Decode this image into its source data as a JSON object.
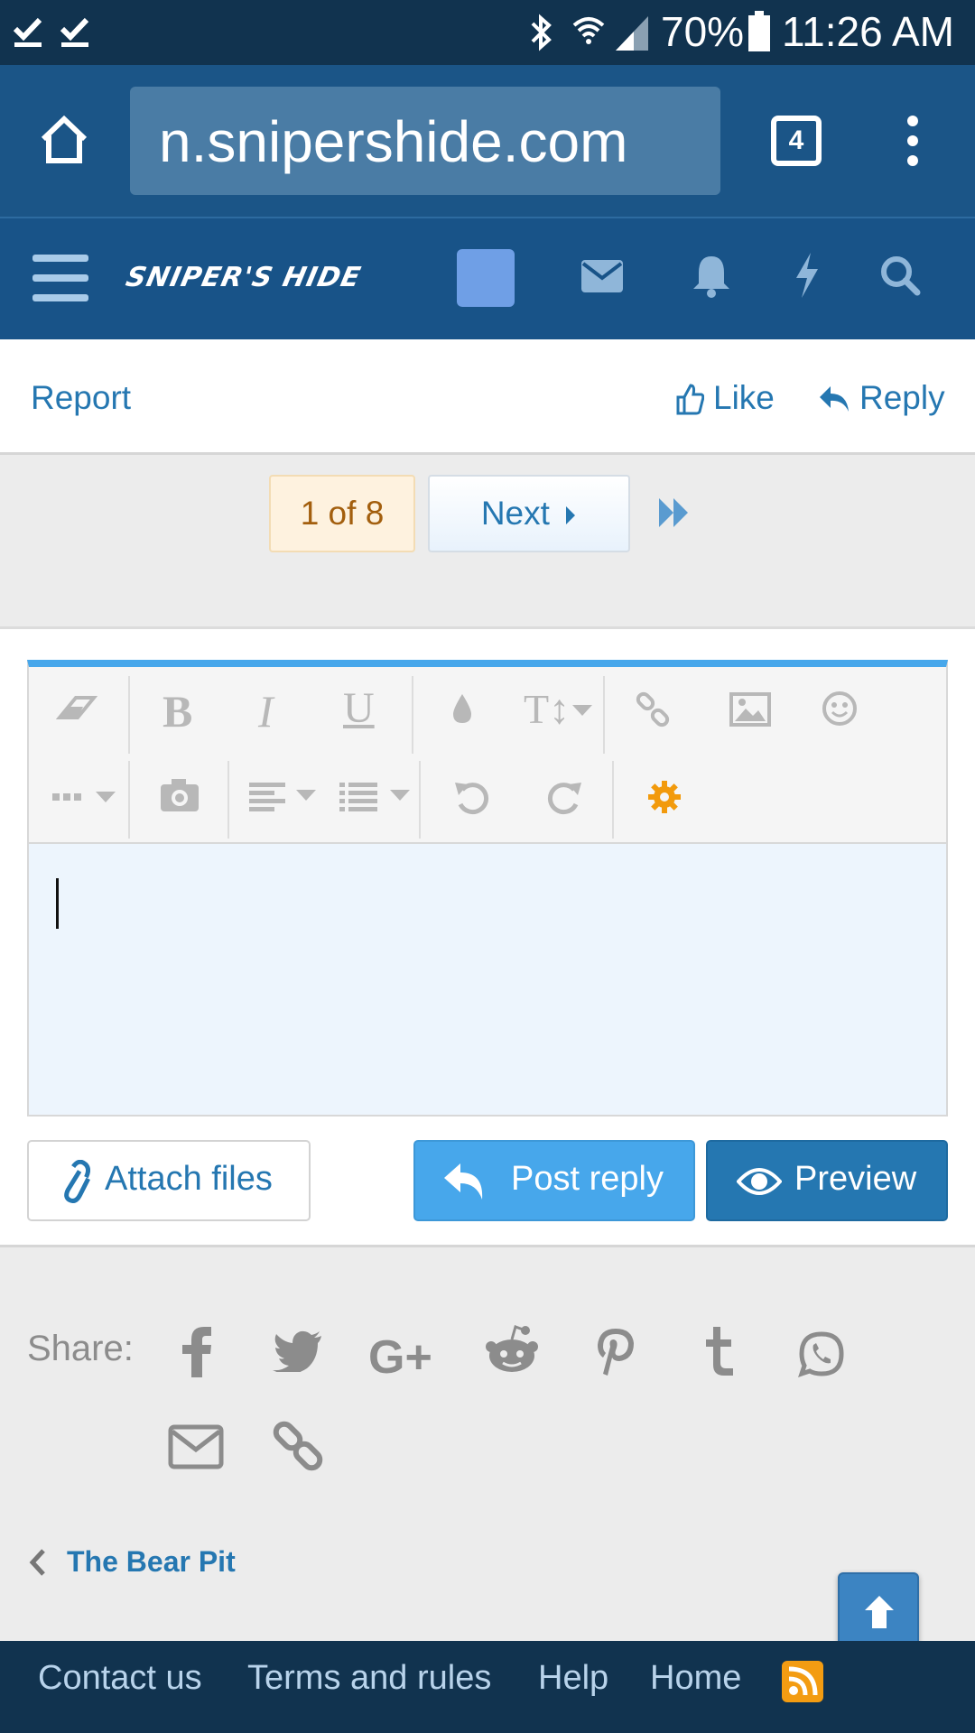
{
  "status_bar": {
    "battery": "70%",
    "time": "11:26 AM"
  },
  "browser": {
    "url": "n.snipershide.com",
    "tab_count": "4"
  },
  "site_nav": {
    "logo_text": "SNIPER'S HIDE"
  },
  "post_actions": {
    "report": "Report",
    "like": "Like",
    "reply": "Reply"
  },
  "pagination": {
    "current": "1 of 8",
    "next": "Next"
  },
  "editor": {
    "text": ""
  },
  "buttons": {
    "attach": "Attach files",
    "post_reply": "Post reply",
    "preview": "Preview"
  },
  "share": {
    "label": "Share:",
    "icons": [
      "facebook-icon",
      "twitter-icon",
      "google-plus-icon",
      "reddit-icon",
      "pinterest-icon",
      "tumblr-icon",
      "whatsapp-icon",
      "email-icon",
      "link-icon"
    ]
  },
  "breadcrumb": {
    "label": "The Bear Pit"
  },
  "footer": {
    "contact": "Contact us",
    "terms": "Terms and rules",
    "help": "Help",
    "home": "Home"
  },
  "colors": {
    "accent": "#2577b1",
    "header": "#185388",
    "status_bar": "#11334f",
    "primary_button": "#47a7eb",
    "rss": "#f39c12"
  }
}
